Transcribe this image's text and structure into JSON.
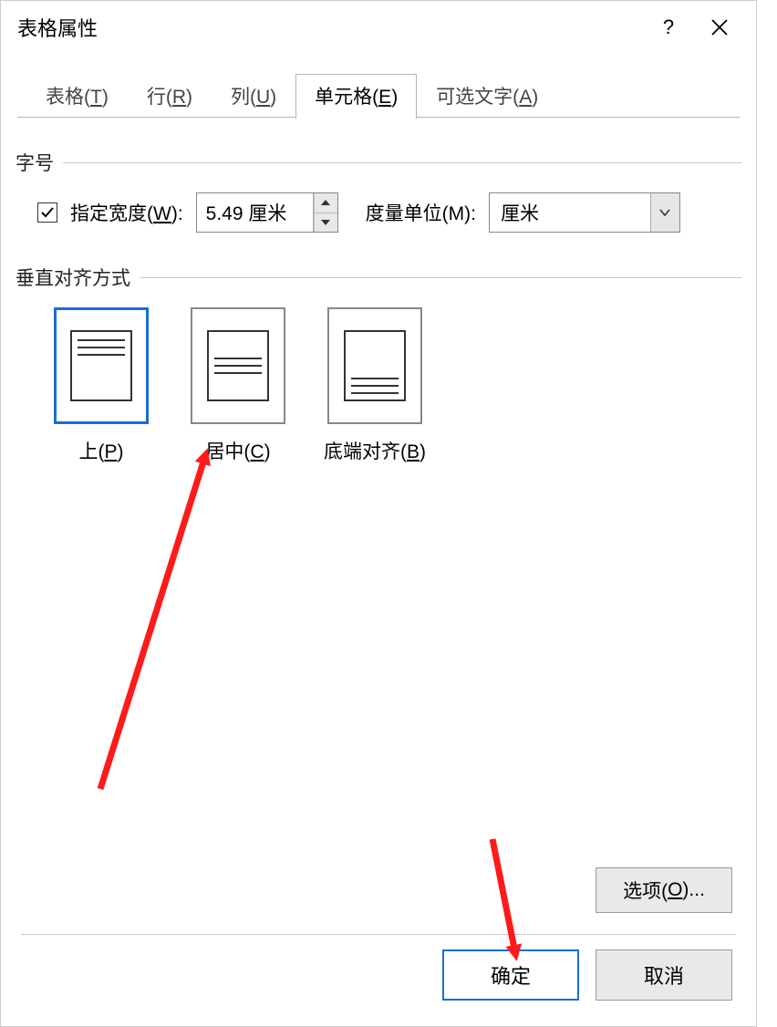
{
  "titlebar": {
    "title": "表格属性",
    "help": "?"
  },
  "tabs": {
    "table": {
      "pre": "表格(",
      "mn": "T",
      "post": ")"
    },
    "row": {
      "pre": "行(",
      "mn": "R",
      "post": ")"
    },
    "col": {
      "pre": "列(",
      "mn": "U",
      "post": ")"
    },
    "cell": {
      "pre": "单元格(",
      "mn": "E",
      "post": ")"
    },
    "alt": {
      "pre": "可选文字(",
      "mn": "A",
      "post": ")"
    }
  },
  "size_group": {
    "heading": "字号",
    "specify_width": {
      "pre": "指定宽度(",
      "mn": "W",
      "post": "):"
    },
    "width_value": "5.49 厘米",
    "measure_label": {
      "pre": "度量单位(",
      "mn": "M",
      "post": "):"
    },
    "unit_value": "厘米"
  },
  "valign_group": {
    "heading": "垂直对齐方式",
    "options": {
      "top": {
        "pre": "上(",
        "mn": "P",
        "post": ")"
      },
      "center": {
        "pre": "居中(",
        "mn": "C",
        "post": ")"
      },
      "bottom": {
        "pre": "底端对齐(",
        "mn": "B",
        "post": ")"
      }
    }
  },
  "options_button": {
    "pre": "选项(",
    "mn": "O",
    "post": ")..."
  },
  "footer": {
    "ok": "确定",
    "cancel": "取消"
  }
}
